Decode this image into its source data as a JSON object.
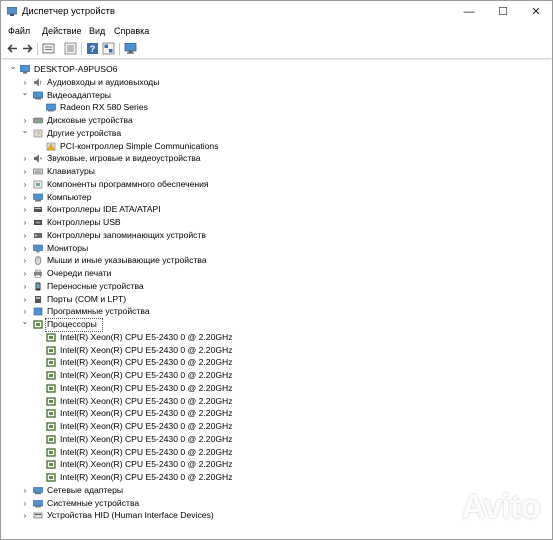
{
  "window": {
    "title": "Диспетчер устройств",
    "controls": {
      "minimize": "—",
      "maximize": "☐",
      "close": "✕"
    }
  },
  "menu": [
    "Файл",
    "Действие",
    "Вид",
    "Справка"
  ],
  "toolbar": [
    "back-arrow-icon",
    "forward-arrow-icon",
    "properties-icon",
    "show-hidden-icon",
    "help-icon",
    "grid-view-icon",
    "monitor-icon"
  ],
  "tree": {
    "root": "DESKTOP-A9PUSO6",
    "categories": [
      {
        "label": "Аудиовходы и аудиовыходы",
        "icon": "speaker-icon",
        "state": "collapsed"
      },
      {
        "label": "Видеоадаптеры",
        "icon": "display-adapter-icon",
        "state": "expanded",
        "children": [
          "Radeon RX 580 Series"
        ]
      },
      {
        "label": "Дисковые устройства",
        "icon": "disk-drive-icon",
        "state": "collapsed"
      },
      {
        "label": "Другие устройства",
        "icon": "unknown-device-icon",
        "state": "expanded",
        "children": [
          "PCI-контроллер Simple Communications"
        ]
      },
      {
        "label": "Звуковые, игровые и видеоустройства",
        "icon": "sound-icon",
        "state": "collapsed"
      },
      {
        "label": "Клавиатуры",
        "icon": "keyboard-icon",
        "state": "collapsed"
      },
      {
        "label": "Компоненты программного обеспечения",
        "icon": "software-component-icon",
        "state": "collapsed"
      },
      {
        "label": "Компьютер",
        "icon": "computer-icon",
        "state": "collapsed"
      },
      {
        "label": "Контроллеры IDE ATA/ATAPI",
        "icon": "ide-controller-icon",
        "state": "collapsed"
      },
      {
        "label": "Контроллеры USB",
        "icon": "usb-icon",
        "state": "collapsed"
      },
      {
        "label": "Контроллеры запоминающих устройств",
        "icon": "storage-controller-icon",
        "state": "collapsed"
      },
      {
        "label": "Мониторы",
        "icon": "monitor-icon",
        "state": "collapsed"
      },
      {
        "label": "Мыши и иные указывающие устройства",
        "icon": "mouse-icon",
        "state": "collapsed"
      },
      {
        "label": "Очереди печати",
        "icon": "printer-icon",
        "state": "collapsed"
      },
      {
        "label": "Переносные устройства",
        "icon": "portable-device-icon",
        "state": "collapsed"
      },
      {
        "label": "Порты (COM и LPT)",
        "icon": "port-icon",
        "state": "collapsed"
      },
      {
        "label": "Программные устройства",
        "icon": "software-device-icon",
        "state": "collapsed"
      },
      {
        "label": "Процессоры",
        "icon": "processor-icon",
        "state": "expanded",
        "selected": true,
        "children": [
          "Intel(R) Xeon(R) CPU E5-2430 0 @ 2.20GHz",
          "Intel(R) Xeon(R) CPU E5-2430 0 @ 2.20GHz",
          "Intel(R) Xeon(R) CPU E5-2430 0 @ 2.20GHz",
          "Intel(R) Xeon(R) CPU E5-2430 0 @ 2.20GHz",
          "Intel(R) Xeon(R) CPU E5-2430 0 @ 2.20GHz",
          "Intel(R) Xeon(R) CPU E5-2430 0 @ 2.20GHz",
          "Intel(R) Xeon(R) CPU E5-2430 0 @ 2.20GHz",
          "Intel(R) Xeon(R) CPU E5-2430 0 @ 2.20GHz",
          "Intel(R) Xeon(R) CPU E5-2430 0 @ 2.20GHz",
          "Intel(R) Xeon(R) CPU E5-2430 0 @ 2.20GHz",
          "Intel(R) Xeon(R) CPU E5-2430 0 @ 2.20GHz",
          "Intel(R) Xeon(R) CPU E5-2430 0 @ 2.20GHz"
        ]
      },
      {
        "label": "Сетевые адаптеры",
        "icon": "network-adapter-icon",
        "state": "collapsed"
      },
      {
        "label": "Системные устройства",
        "icon": "system-device-icon",
        "state": "collapsed"
      },
      {
        "label": "Устройства HID (Human Interface Devices)",
        "icon": "hid-icon",
        "state": "collapsed"
      }
    ]
  },
  "watermark": "Avito",
  "colors": {
    "accent": "#2b78c5",
    "processor_green": "#3f6b2a"
  }
}
